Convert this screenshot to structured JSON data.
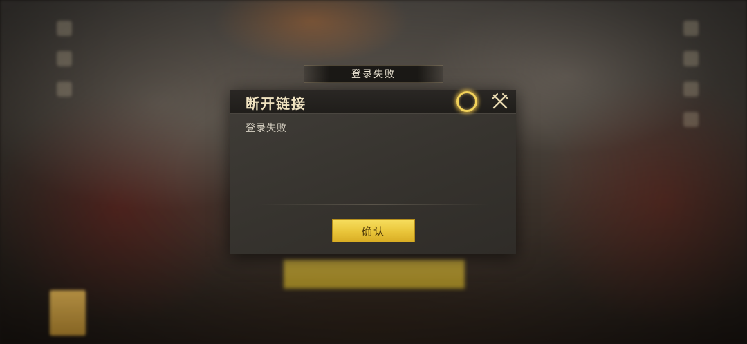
{
  "banner": {
    "title": "登录失败"
  },
  "dialog": {
    "title": "断开链接",
    "message": "登录失败",
    "confirm_label": "确认",
    "accent_color": "#f2d25a"
  },
  "icons": {
    "ring": "glowing-ring-icon",
    "close": "crossed-swords-close-icon"
  }
}
